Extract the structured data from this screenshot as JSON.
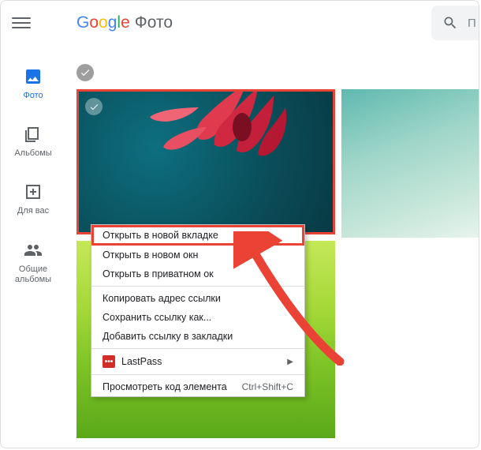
{
  "header": {
    "app_name": "Фото",
    "search_placeholder": "П"
  },
  "sidebar": {
    "items": [
      {
        "label": "Фото"
      },
      {
        "label": "Альбомы"
      },
      {
        "label": "Для вас"
      },
      {
        "label": "Общие альбомы"
      }
    ]
  },
  "context_menu": {
    "items": [
      {
        "label": "Открыть в новой вкладке"
      },
      {
        "label": "Открыть в новом окн"
      },
      {
        "label": "Открыть в приватном ок"
      },
      {
        "label": "Копировать адрес ссылки"
      },
      {
        "label": "Сохранить ссылку как..."
      },
      {
        "label": "Добавить ссылку в закладки"
      },
      {
        "label": "LastPass"
      },
      {
        "label": "Просмотреть код элемента",
        "shortcut": "Ctrl+Shift+C"
      }
    ]
  },
  "colors": {
    "accent": "#1a73e8",
    "highlight": "#ea4335"
  }
}
